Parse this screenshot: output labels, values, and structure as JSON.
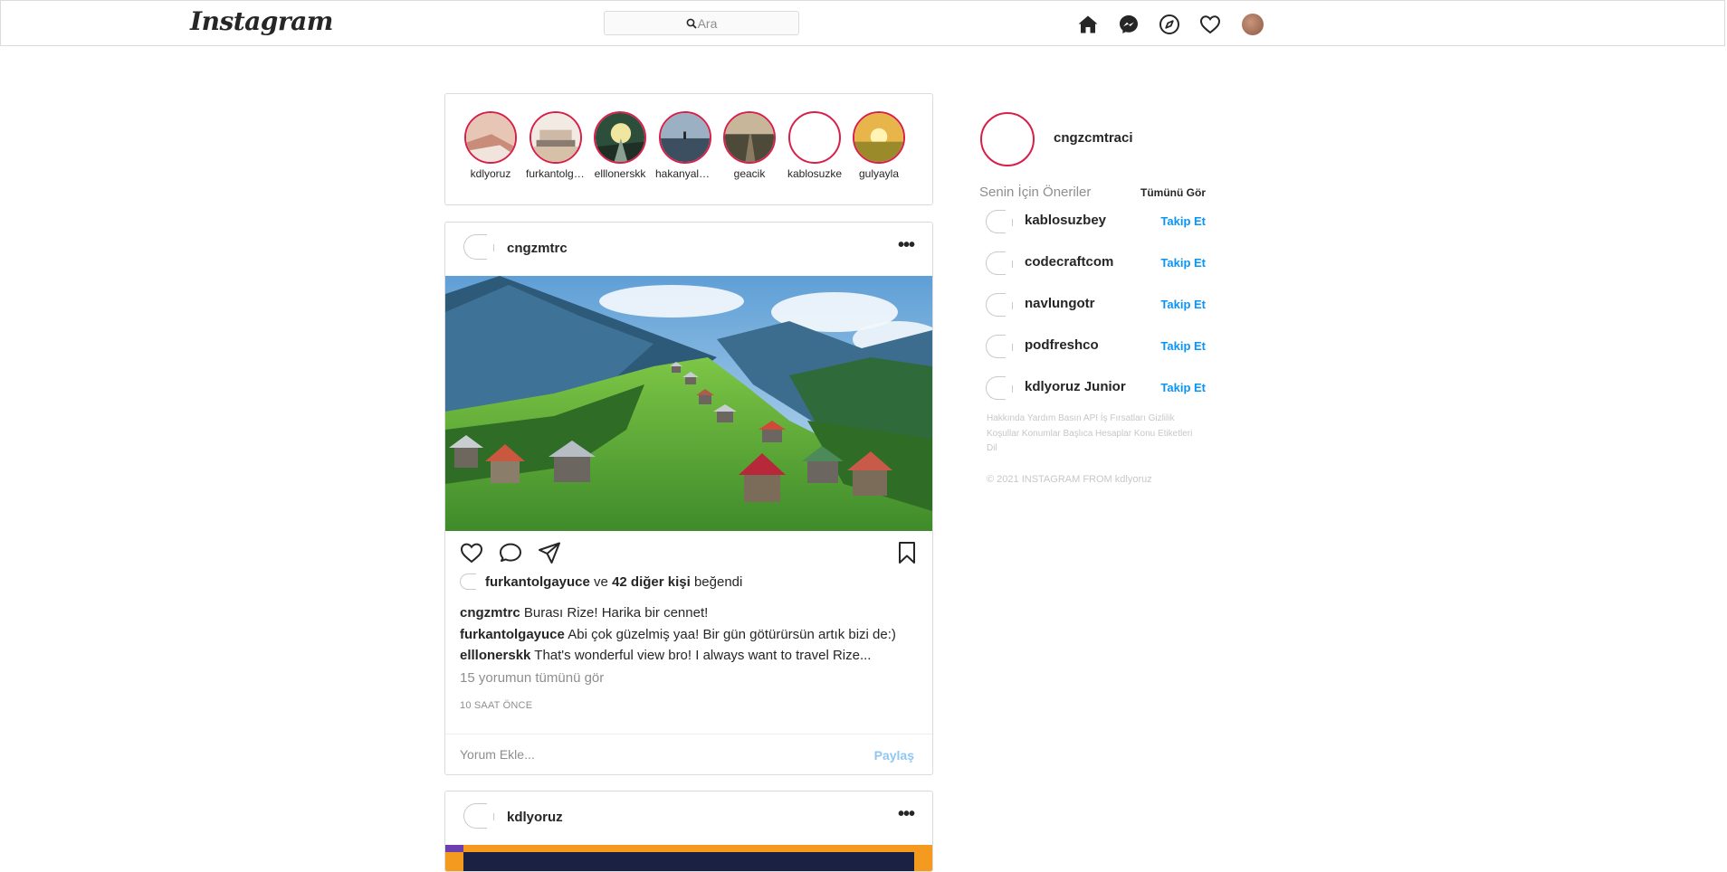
{
  "nav": {
    "logo": "Instagram",
    "search_placeholder": "Ara",
    "icons": [
      "home-icon",
      "messenger-icon",
      "explore-icon",
      "heart-icon",
      "profile-avatar"
    ]
  },
  "stories": [
    {
      "name": "kdlyoruz"
    },
    {
      "name": "furkantolga..."
    },
    {
      "name": "elllonerskk"
    },
    {
      "name": "hakanyalcin..."
    },
    {
      "name": "geacik"
    },
    {
      "name": "kablosuzke"
    },
    {
      "name": "gulyayla"
    }
  ],
  "post": {
    "username": "cngzmtrc",
    "more": "•••",
    "liked_by": "furkantolgayuce",
    "likes_and": "ve",
    "likes_others": "42 diğer kişi",
    "likes_suffix": "beğendi",
    "comments": [
      {
        "user": "cngzmtrc",
        "text": "Burası Rize! Harika bir cennet!"
      },
      {
        "user": "furkantolgayuce",
        "text": "Abi çok güzelmiş yaa! Bir gün götürürsün artık bizi de:)"
      },
      {
        "user": "elllonerskk",
        "text": "That's wonderful view bro! I always want to travel Rize..."
      }
    ],
    "view_all": "15 yorumun tümünü gör",
    "time": "10 SAAT ÖNCE",
    "comment_placeholder": "Yorum Ekle...",
    "share_label": "Paylaş"
  },
  "post2": {
    "username": "kdlyoruz",
    "more": "•••"
  },
  "sidebar": {
    "username": "cngzcmtraci",
    "suggestions_title": "Senin İçin Öneriler",
    "see_all": "Tümünü Gör",
    "suggestions": [
      {
        "name": "kablosuzbey",
        "action": "Takip Et"
      },
      {
        "name": "codecraftcom",
        "action": "Takip Et"
      },
      {
        "name": "navlungotr",
        "action": "Takip Et"
      },
      {
        "name": "podfreshco",
        "action": "Takip Et"
      },
      {
        "name": "kdlyoruz Junior",
        "action": "Takip Et"
      }
    ],
    "footer_links": "Hakkında Yardım Basın API İş Fırsatları Gizlilik Koşullar Konumlar Başlıca Hesaplar Konu Etiketleri Dil",
    "copyright": "© 2021 INSTAGRAM FROM kdlyoruz"
  },
  "colors": {
    "story_ring": "#d6204a",
    "link_blue": "#0a95f6",
    "share_light_blue": "#8fc7f4",
    "border": "#dbdbdb"
  }
}
